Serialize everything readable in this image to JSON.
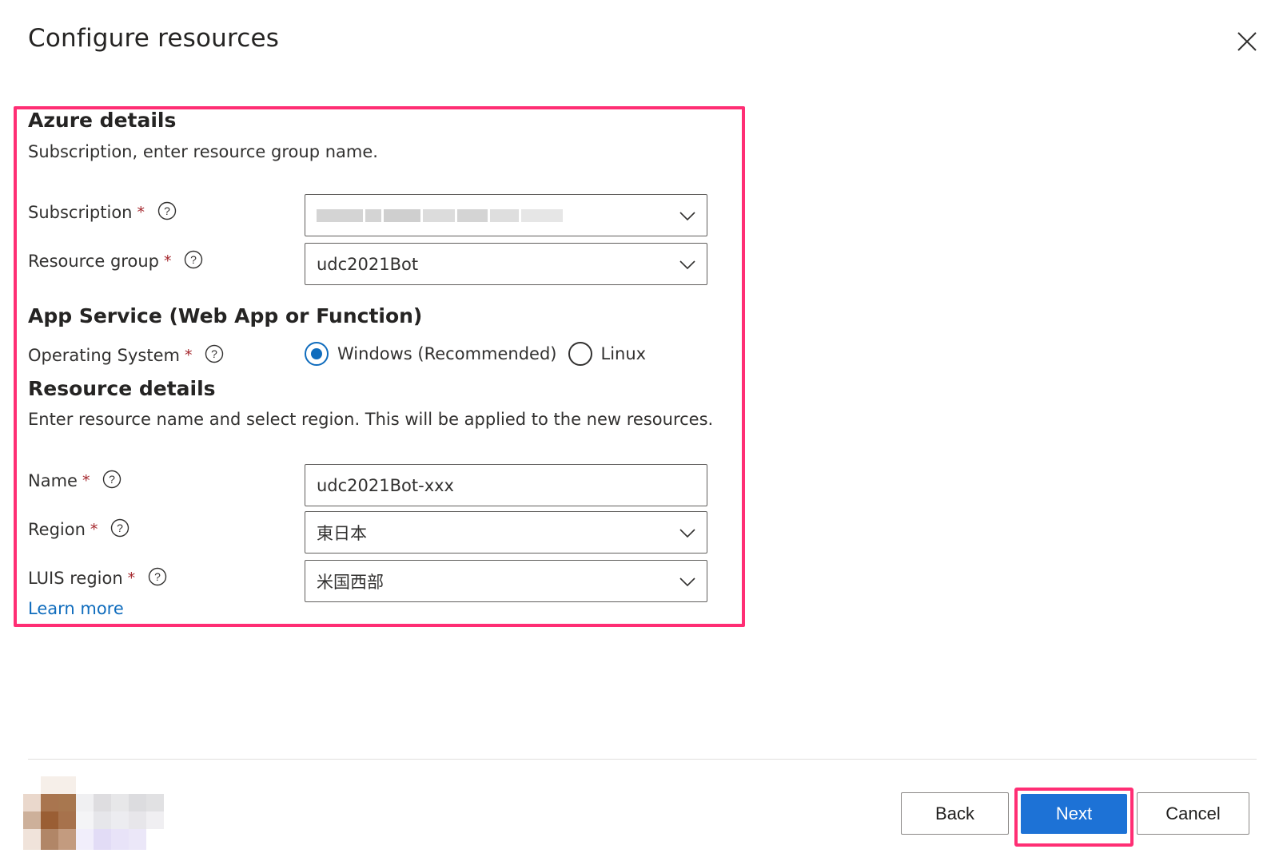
{
  "dialog": {
    "title": "Configure resources"
  },
  "azure_details": {
    "title": "Azure details",
    "description": "Subscription, enter resource group name.",
    "subscription": {
      "label": "Subscription",
      "required_mark": "*"
    },
    "resource_group": {
      "label": "Resource group",
      "required_mark": "*",
      "value": "udc2021Bot"
    }
  },
  "app_service": {
    "title": "App Service (Web App or Function)",
    "operating_system": {
      "label": "Operating System",
      "required_mark": "*",
      "options": [
        {
          "label": "Windows (Recommended)",
          "selected": true
        },
        {
          "label": "Linux",
          "selected": false
        }
      ]
    }
  },
  "resource_details": {
    "title": "Resource details",
    "description": "Enter resource name and select region. This will be applied to the new resources.",
    "name": {
      "label": "Name",
      "required_mark": "*",
      "value": "udc2021Bot-xxx"
    },
    "region": {
      "label": "Region",
      "required_mark": "*",
      "value": "東日本"
    },
    "luis_region": {
      "label": "LUIS region",
      "required_mark": "*",
      "value": "米国西部"
    },
    "learn_more": "Learn more"
  },
  "footer": {
    "back_label": "Back",
    "next_label": "Next",
    "cancel_label": "Cancel"
  },
  "colors": {
    "accent": "#1d72d6",
    "highlight": "#ff2e74",
    "required": "#a4262c"
  }
}
